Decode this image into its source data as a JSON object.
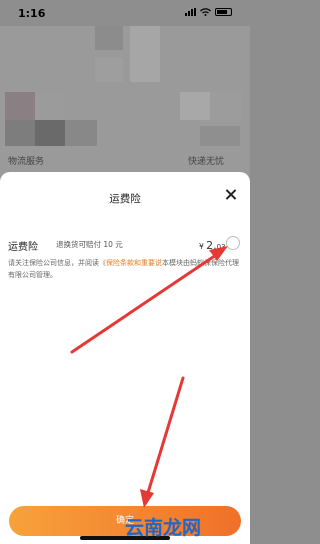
{
  "status_bar": {
    "time": "1:16"
  },
  "background": {
    "text_left": "物流服务",
    "text_right": "快递无忧"
  },
  "sheet": {
    "title": "运费险",
    "insurance": {
      "name": "运费险",
      "description": "退换货可赔付 10 元",
      "price_symbol": "¥",
      "price_main": "2.",
      "price_decimal": "03"
    },
    "notice": {
      "prefix": "请关注保险公司信息，并阅读",
      "link": "《保险条款和重要说",
      "suffix": "本模块由蚂蚁保保险代理有限公司管理。"
    },
    "confirm_label": "确定"
  },
  "watermark": "云南龙网",
  "colors": {
    "accent_orange": "#f07029",
    "link_orange": "#e07b20",
    "arrow_red": "#e53935",
    "watermark_blue": "#1f66c7"
  }
}
